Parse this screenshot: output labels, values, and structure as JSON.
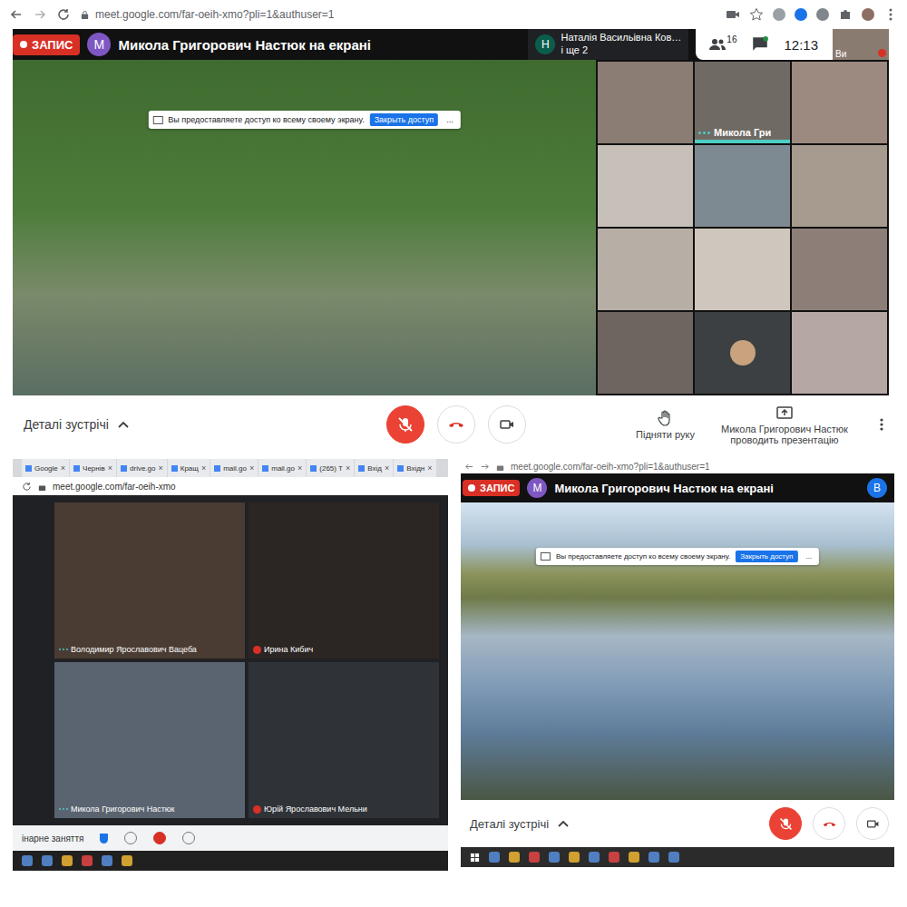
{
  "main_window": {
    "url": "meet.google.com/far-oeih-xmo?pli=1&authuser=1",
    "record": "ЗАПИС",
    "presenter_avatar": "M",
    "presenter_title": "Микола Григорович Настюк на екрані",
    "speaker": {
      "avatar": "Н",
      "name": "Наталія Васильівна Ков…",
      "more": "і ще 2"
    },
    "participants_count": "16",
    "time": "12:13",
    "self": {
      "label": "Ви",
      "muted": true
    },
    "share_banner": {
      "text": "Вы предоставляете доступ ко всему своему экрану.",
      "button": "Закрыть доступ",
      "more": "..."
    },
    "tiles": [
      {
        "kind": "video",
        "name": "",
        "speaking": false
      },
      {
        "kind": "video",
        "name": "Микола Гри",
        "speaking": true
      },
      {
        "kind": "video",
        "name": "",
        "speaking": false
      },
      {
        "kind": "video",
        "name": "",
        "speaking": false
      },
      {
        "kind": "video",
        "name": "",
        "speaking": false
      },
      {
        "kind": "video",
        "name": "",
        "speaking": false
      },
      {
        "kind": "video",
        "name": "",
        "speaking": false
      },
      {
        "kind": "video",
        "name": "",
        "speaking": false
      },
      {
        "kind": "video",
        "name": "",
        "speaking": false
      },
      {
        "kind": "video",
        "name": "",
        "speaking": false
      },
      {
        "kind": "avatar",
        "name": "",
        "speaking": false
      },
      {
        "kind": "video",
        "name": "",
        "speaking": false
      }
    ],
    "controls": {
      "details": "Деталі зустрічі",
      "mic_muted": true,
      "raise_hand": "Підняти руку",
      "presenting": "Микола Григорович Настюк проводить презентацію"
    }
  },
  "photo_of_screen": {
    "tabs": [
      "Google",
      "Чернів",
      "drive.go",
      "Кращ",
      "mail.go",
      "mail.go",
      "(265) T",
      "Вхід",
      "Вхідн"
    ],
    "tab_close": "×",
    "url": "meet.google.com/far-oeih-xmo",
    "tiles": [
      {
        "name": "Володимир Ярославович Вацеба",
        "muted": false,
        "speaking": true
      },
      {
        "name": "Ирина Кибич",
        "muted": true,
        "speaking": false
      },
      {
        "name": "Микола Григорович Настюк",
        "muted": false,
        "speaking": true
      },
      {
        "name": "Юрій Ярославович Мельни",
        "muted": true,
        "speaking": false
      }
    ],
    "footer": "інарне заняття"
  },
  "second_window": {
    "url": "meet.google.com/far-oeih-xmo?pli=1&authuser=1",
    "record": "ЗАПИС",
    "presenter_avatar": "M",
    "presenter_title": "Микола Григорович Настюк на екрані",
    "self_avatar": "B",
    "share_banner": {
      "text": "Вы предоставляете доступ ко всему своему экрану.",
      "button": "Закрыть доступ",
      "more": "..."
    },
    "controls": {
      "details": "Деталі зустрічі",
      "mic_muted": true
    }
  }
}
